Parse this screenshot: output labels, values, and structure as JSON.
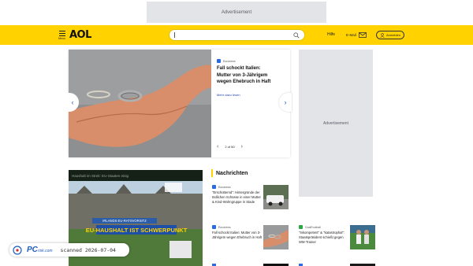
{
  "top_ad": {
    "label": "Advertisement"
  },
  "header": {
    "menu_label": "Menu",
    "logo": "AOL",
    "search": {
      "value": ""
    },
    "help": "Hilfe",
    "mail": "E-Mail",
    "login": "Anmelden",
    "brand_color": "#ffd200"
  },
  "hero": {
    "source": "Euronews",
    "title": "Fall schockt Italien: Mutter von 3-Jährigem wegen Ehebruch in Haft",
    "more": "Mehr dazu lesen",
    "pager": "2 of 50"
  },
  "side_ad": {
    "label": "Advertisement"
  },
  "video": {
    "caption": "Haushalt im Streit: EU-Staaten einig",
    "tag": "IRLANDS EU-RATSVORSITZ",
    "headline": "EU-HAUSHALT IST SCHWERPUNKT"
  },
  "news_section": {
    "title": "Nachrichten",
    "items": [
      {
        "source": "Euronews",
        "title": "\"Erschütternd\": Hintergründe der tödlichen Schüsse in einer Mutter & Kind-Wohngruppe in Stade"
      },
      {
        "source": "Euronews",
        "title": "Fall schockt Italien: Mutter von 3-Jährigem wegen Ehebruch in Haft"
      },
      {
        "source": "GoalFootball",
        "title": "\"Inkompetent\" & \"katastrophal\": Staatspräsident schießt gegen WM-Trainer"
      }
    ]
  },
  "watermark": {
    "brand": "PC",
    "brand_suffix": "risk.com",
    "scan": "scanned 2026-07-04"
  }
}
